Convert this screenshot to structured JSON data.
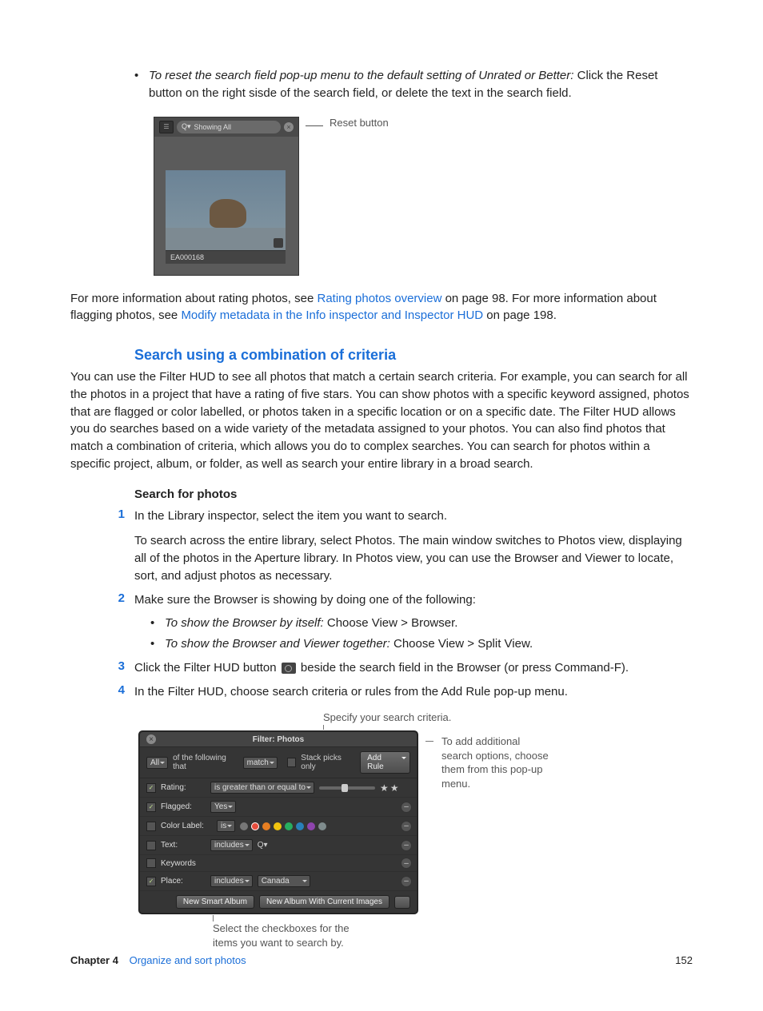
{
  "bullet1": {
    "lead": "To reset the search field pop-up menu to the default setting of Unrated or Better: ",
    "rest": "Click the Reset button on the right sisde of the search field, or delete the text in the search field."
  },
  "fig1": {
    "search_placeholder": "Showing All",
    "thumb_caption": "EA000168",
    "label": "Reset button"
  },
  "para_rating": {
    "t1": "For more information about rating photos, see ",
    "link1": "Rating photos overview",
    "t2": " on page 98. For more information about flagging photos, see ",
    "link2": "Modify metadata in the Info inspector and Inspector HUD",
    "t3": " on page 198."
  },
  "section_heading": "Search using a combination of criteria",
  "section_para": "You can use the Filter HUD to see all photos that match a certain search criteria. For example, you can search for all the photos in a project that have a rating of five stars. You can show photos with a specific keyword assigned, photos that are flagged or color labelled, or photos taken in a specific location or on a specific date. The Filter HUD allows you do searches based on a wide variety of the metadata assigned to your photos. You can also find photos that match a combination of criteria, which allows you do to complex searches. You can search for photos within a specific project, album, or folder, as well as search your entire library in a broad search.",
  "sub_heading": "Search for photos",
  "steps": {
    "s1a": "In the Library inspector, select the item you want to search.",
    "s1b": "To search across the entire library, select Photos. The main window switches to Photos view, displaying all of the photos in the Aperture library. In Photos view, you can use the Browser and Viewer to locate, sort, and adjust photos as necessary.",
    "s2": "Make sure the Browser is showing by doing one of the following:",
    "s2_b1_lead": "To show the Browser by itself: ",
    "s2_b1_rest": "Choose View > Browser.",
    "s2_b2_lead": "To show the Browser and Viewer together: ",
    "s2_b2_rest": "Choose View > Split View.",
    "s3a": "Click the Filter HUD button ",
    "s3b": " beside the search field in the Browser (or press Command-F).",
    "s4": "In the Filter HUD, choose search criteria or rules from the Add Rule pop-up menu."
  },
  "fig2": {
    "callout_top": "Specify your search criteria.",
    "callout_right": "To add additional search options, choose them from this pop-up menu.",
    "callout_bottom": "Select the checkboxes for the items you want to search by.",
    "hud": {
      "title": "Filter: Photos",
      "all": "All",
      "of_following": "of the following that",
      "match": "match",
      "stack_picks": "Stack picks only",
      "add_rule": "Add Rule",
      "rows": {
        "rating_label": "Rating:",
        "rating_op": "is greater than or equal to",
        "flagged_label": "Flagged:",
        "flagged_val": "Yes",
        "color_label": "Color Label:",
        "color_op": "is",
        "text_label": "Text:",
        "text_op": "includes",
        "keywords_label": "Keywords",
        "place_label": "Place:",
        "place_op": "includes",
        "place_val": "Canada"
      },
      "footer": {
        "new_smart": "New Smart Album",
        "new_album": "New Album With Current Images"
      }
    }
  },
  "footer": {
    "chapter": "Chapter 4",
    "title": "Organize and sort photos",
    "page": "152"
  }
}
